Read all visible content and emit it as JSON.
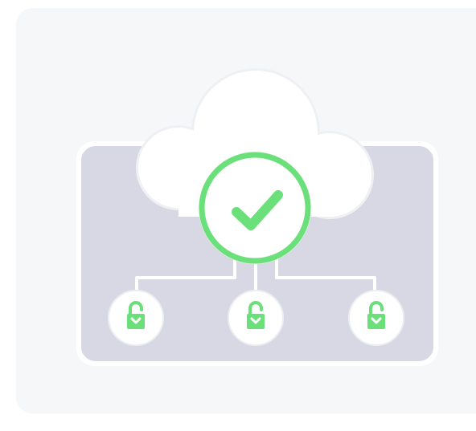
{
  "illustration": {
    "card_color": "#f6f7f9",
    "panel_color": "#d7d8e3",
    "cloud_color": "#ffffff",
    "accent_color": "#6be07a",
    "connector_color": "#ffffff",
    "icons": {
      "status": "checkmark-icon",
      "locks": [
        "unlocked-padlock-icon",
        "unlocked-padlock-icon",
        "unlocked-padlock-icon"
      ]
    }
  }
}
